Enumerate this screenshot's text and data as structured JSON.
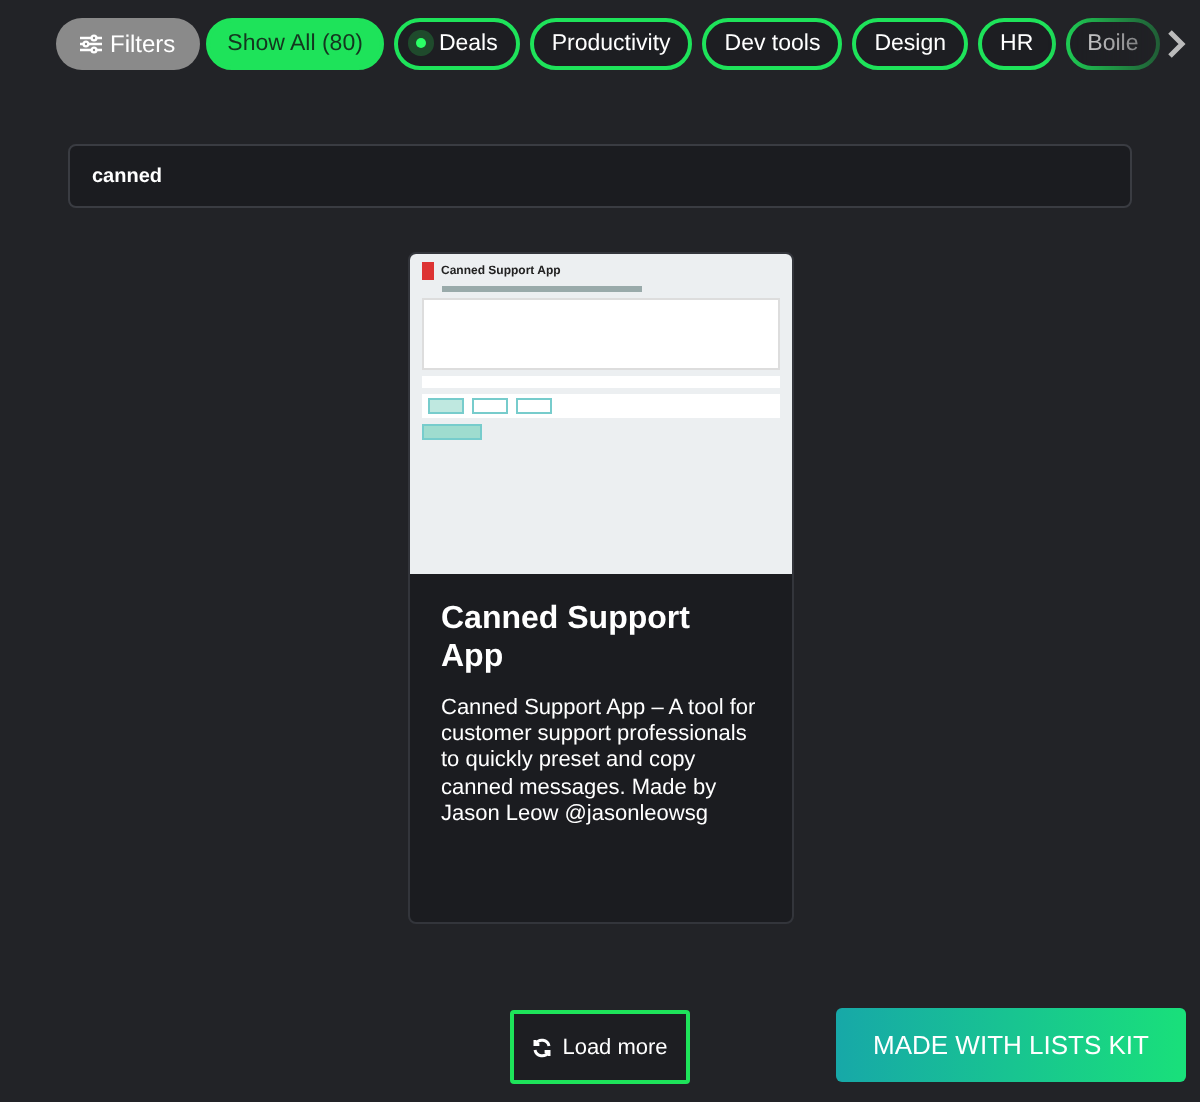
{
  "filter_button": {
    "label": "Filters"
  },
  "chips": [
    {
      "label": "Show All (80)",
      "selected": true,
      "dot": false
    },
    {
      "label": "Deals",
      "selected": false,
      "dot": true
    },
    {
      "label": "Productivity",
      "selected": false,
      "dot": false
    },
    {
      "label": "Dev tools",
      "selected": false,
      "dot": false
    },
    {
      "label": "Design",
      "selected": false,
      "dot": false
    },
    {
      "label": "HR",
      "selected": false,
      "dot": false
    },
    {
      "label": "Boile",
      "selected": false,
      "dot": false
    }
  ],
  "search": {
    "value": "canned"
  },
  "cards": [
    {
      "thumbnail_title": "Canned Support App",
      "title": "Canned Support App",
      "description": "Canned Support App – A tool for customer support professionals to quickly preset and copy canned messages. Made by Jason Leow @jasonleowsg"
    }
  ],
  "load_more": {
    "label": "Load more"
  },
  "badge": {
    "label": "MADE WITH LISTS KIT"
  }
}
